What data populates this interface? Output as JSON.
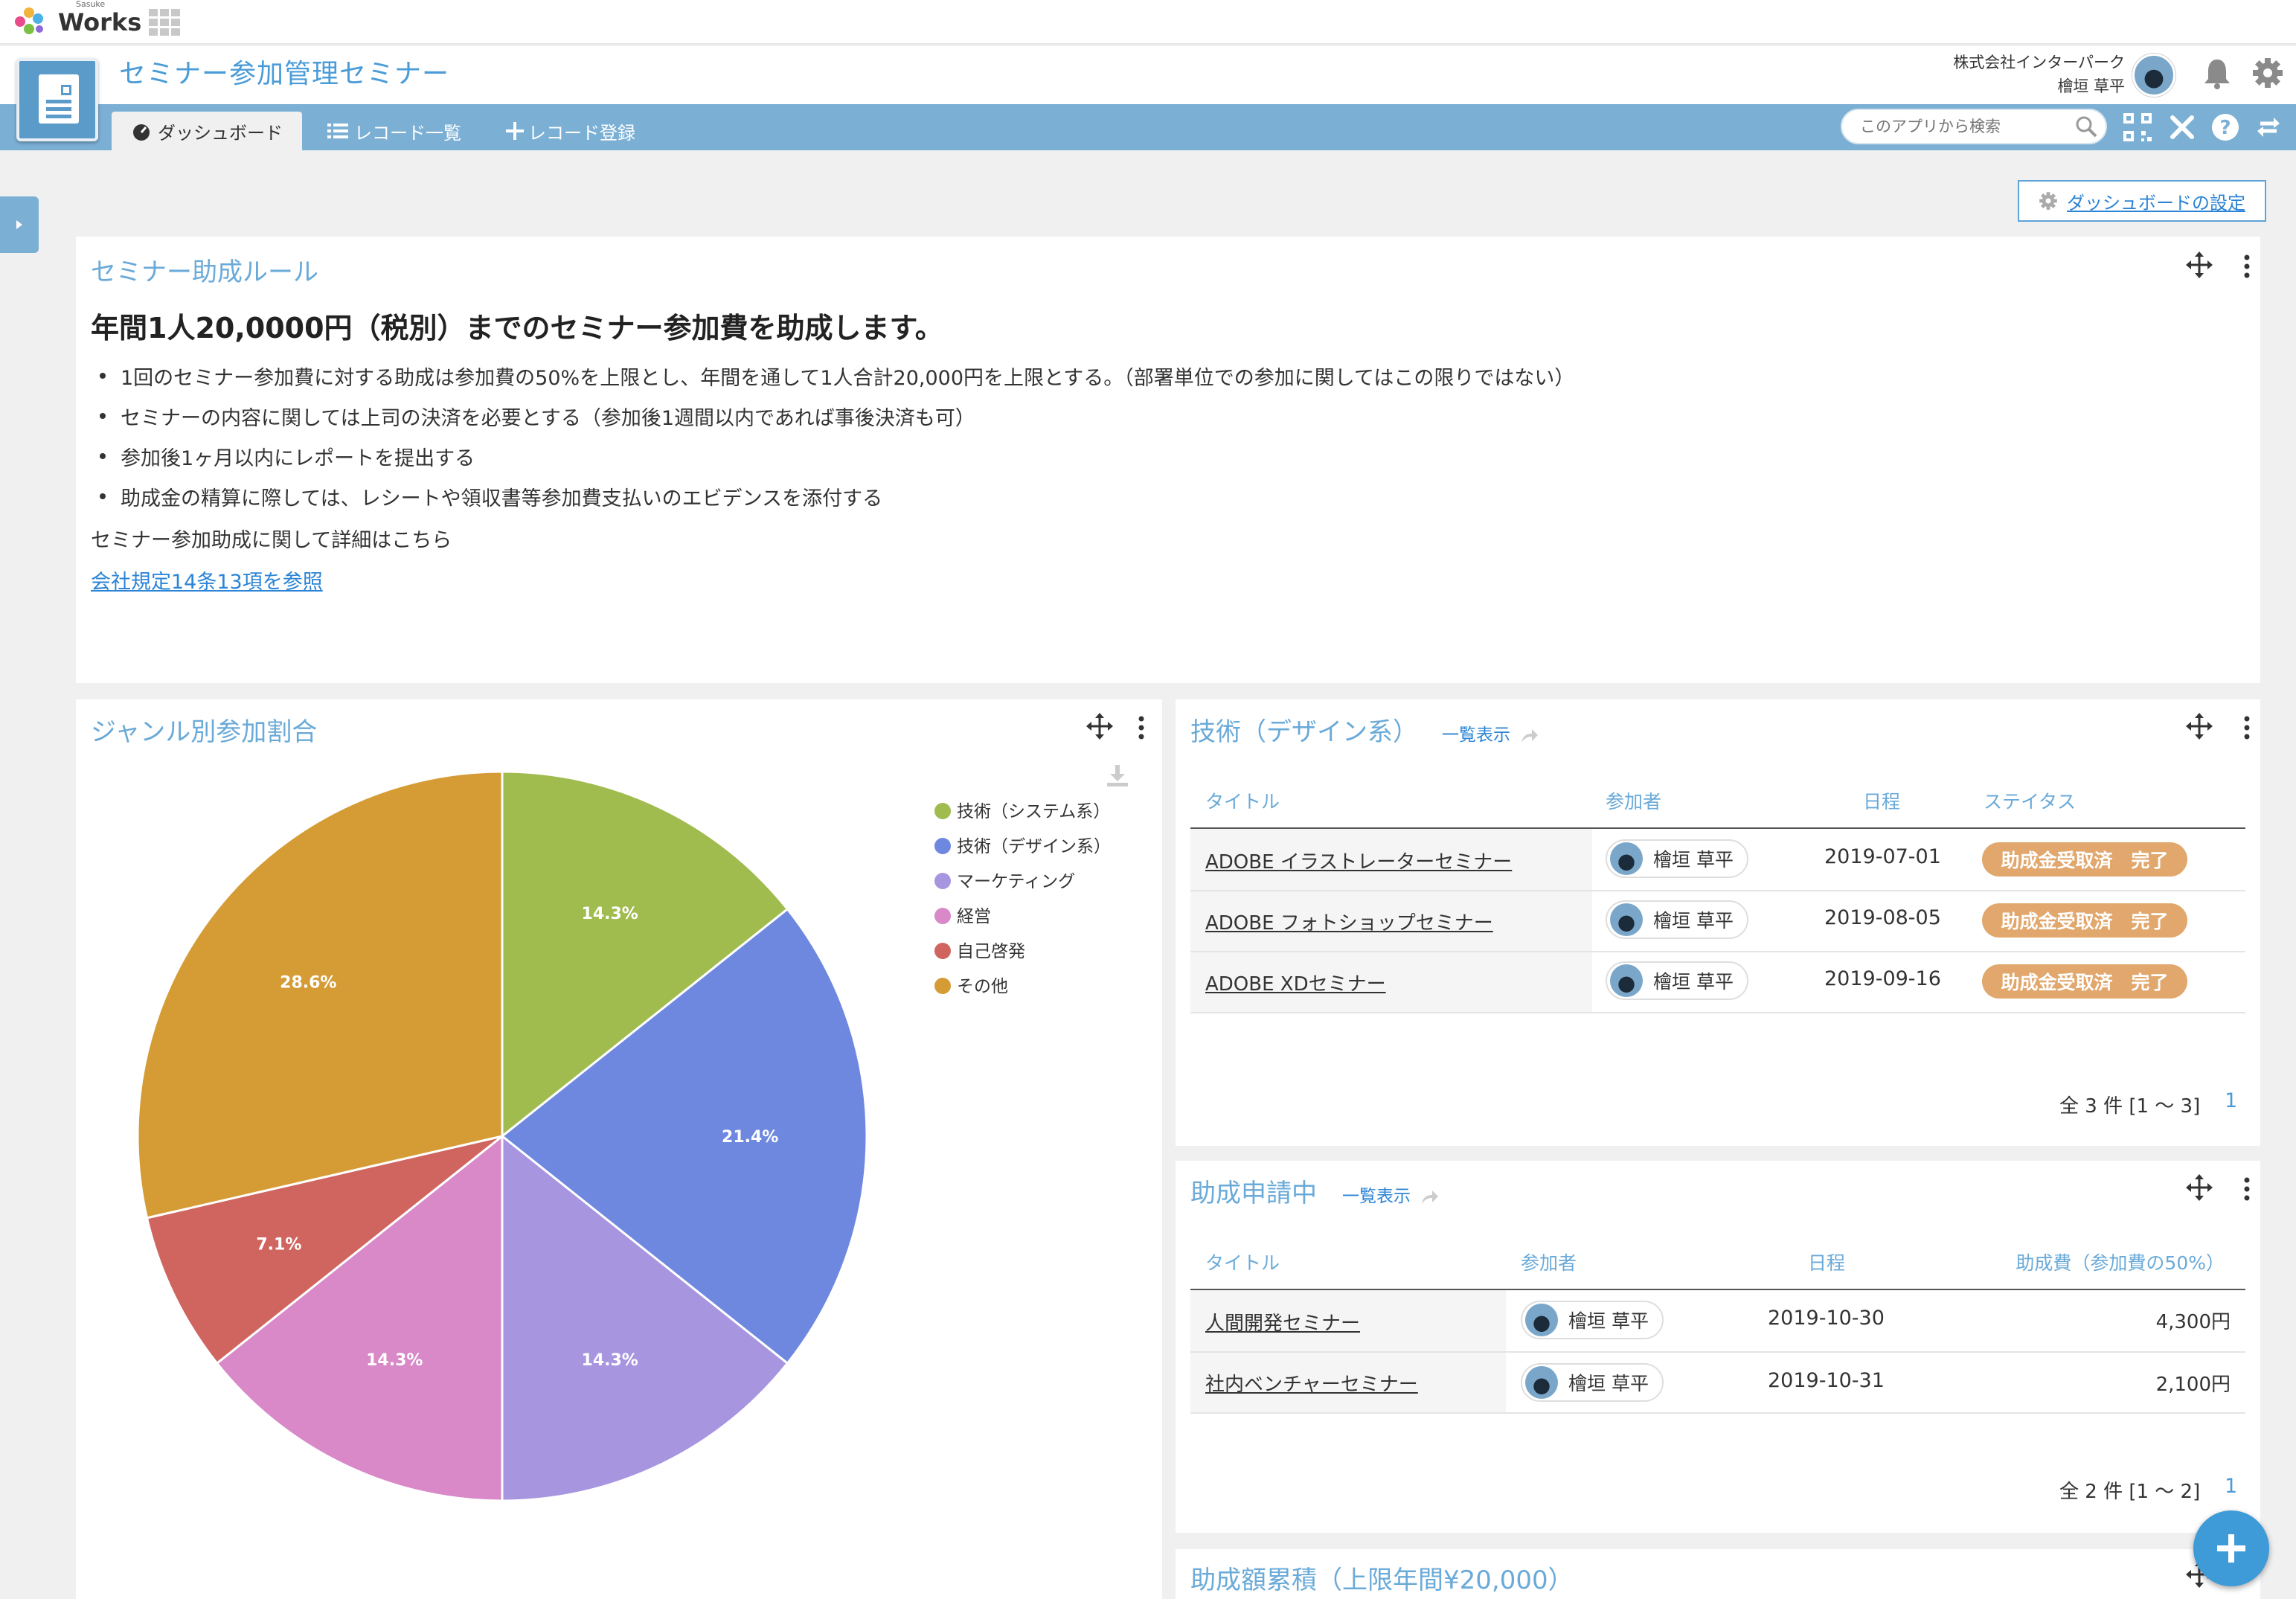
{
  "brand": {
    "small": "Sasuke",
    "word": "Works"
  },
  "app": {
    "title": "セミナー参加管理セミナー",
    "company": "株式会社インターパーク",
    "user": "檜垣 草平"
  },
  "nav": {
    "tabs": [
      "ダッシュボード",
      "レコード一覧",
      "レコード登録"
    ],
    "search_placeholder": "このアプリから検索"
  },
  "dashboard_settings": "ダッシュボードの設定",
  "rules": {
    "title": "セミナー助成ルール",
    "heading": "年間1人20,0000円（税別）までのセミナー参加費を助成します。",
    "items": [
      "1回のセミナー参加費に対する助成は参加費の50%を上限とし、年間を通して1人合計20,000円を上限とする。（部署単位での参加に関してはこの限りではない）",
      "セミナーの内容に関しては上司の決済を必要とする（参加後1週間以内であれば事後決済も可）",
      "参加後1ヶ月以内にレポートを提出する",
      "助成金の精算に際しては、レシートや領収書等参加費支払いのエビデンスを添付する"
    ],
    "note": "セミナー参加助成に関して詳細はこちら",
    "link": "会社規定14条13項を参照"
  },
  "pie_panel": {
    "title": "ジャンル別参加割合"
  },
  "chart_data": {
    "type": "pie",
    "title": "",
    "categories": [
      "技術（システム系）",
      "技術（デザイン系）",
      "マーケティング",
      "経営",
      "自己啓発",
      "その他"
    ],
    "values": [
      14.3,
      21.4,
      14.3,
      14.3,
      7.1,
      28.6
    ],
    "labels": [
      "14.3%",
      "21.4%",
      "14.3%",
      "14.3%",
      "7.1%",
      "28.6%"
    ],
    "colors": [
      "#a0bb4e",
      "#6e88e0",
      "#a795e0",
      "#d988c8",
      "#d0655f",
      "#d59c36"
    ],
    "legend_position": "top-right"
  },
  "design_panel": {
    "title": "技術（デザイン系）",
    "view_all": "一覧表示",
    "columns": [
      "タイトル",
      "参加者",
      "日程",
      "ステイタス"
    ],
    "rows": [
      {
        "title": "ADOBE イラストレーターセミナー",
        "participant": "檜垣 草平",
        "date": "2019-07-01",
        "status": "助成金受取済　完了"
      },
      {
        "title": "ADOBE フォトショップセミナー",
        "participant": "檜垣 草平",
        "date": "2019-08-05",
        "status": "助成金受取済　完了"
      },
      {
        "title": "ADOBE XDセミナー",
        "participant": "檜垣 草平",
        "date": "2019-09-16",
        "status": "助成金受取済　完了"
      }
    ],
    "pager": "全 3 件 [1 〜 3]",
    "page": "1"
  },
  "applying_panel": {
    "title": "助成申請中",
    "view_all": "一覧表示",
    "columns": [
      "タイトル",
      "参加者",
      "日程",
      "助成費（参加費の50%）"
    ],
    "rows": [
      {
        "title": "人間開発セミナー",
        "participant": "檜垣 草平",
        "date": "2019-10-30",
        "amount": "4,300円"
      },
      {
        "title": "社内ベンチャーセミナー",
        "participant": "檜垣 草平",
        "date": "2019-10-31",
        "amount": "2,100円"
      }
    ],
    "pager": "全 2 件 [1 〜 2]",
    "page": "1"
  },
  "cumulative_panel": {
    "title": "助成額累積（上限年間¥20,000）"
  },
  "colors": {
    "accent": "#7bafd4",
    "title": "#6aaad8",
    "link": "#2b84d6",
    "status": "#e1a76c",
    "fab": "#3f9ad8"
  }
}
